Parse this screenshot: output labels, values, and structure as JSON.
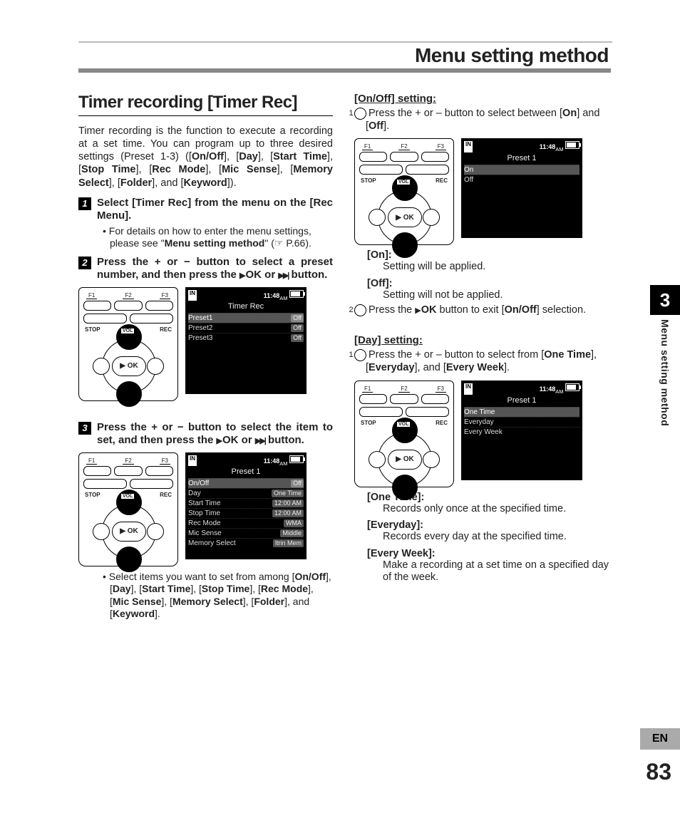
{
  "chapter_title": "Menu setting method",
  "side_tab": {
    "num": "3",
    "label": "Menu setting method"
  },
  "lang_box": "EN",
  "page_number": "83",
  "left": {
    "heading": "Timer recording [Timer Rec]",
    "intro": "Timer recording is the function to execute a recording at a set time. You can program up to three desired settings (Preset 1-3) ([On/Off], [Day], [Start Time], [Stop Time], [Rec Mode], [Mic Sense], [Memory Select], [Folder], and [Keyword]).",
    "step1": "Select [Timer Rec] from the menu on the [Rec Menu].",
    "step1_note_a": "For details on how to enter the menu settings, please see \"",
    "step1_note_b": "Menu setting method",
    "step1_note_c": "\" (☞ P.66).",
    "step2": "Press the + or − button to select a preset number, and then press the ▶OK or ▶▶| button.",
    "step3": "Press the + or − button to select the item to set, and then press the ▶OK or ▶▶| button.",
    "step3_note": "Select items you want to set from among [On/Off], [Day], [Start Time], [Stop Time], [Rec Mode], [Mic Sense], [Memory Select], [Folder], and [Keyword].",
    "fkeys": {
      "f1": "F1",
      "f2": "F2",
      "f3": "F3"
    },
    "stop": "STOP",
    "rec": "REC",
    "vol": "VOL",
    "ok": "▶ OK",
    "lcd_time": "11:48",
    "lcd_am": "AM",
    "lcd1_title": "Timer Rec",
    "lcd1_rows": [
      {
        "l": "Preset1",
        "r": "Off",
        "sel": true
      },
      {
        "l": "Preset2",
        "r": "Off"
      },
      {
        "l": "Preset3",
        "r": "Off"
      }
    ],
    "lcd2_title": "Preset 1",
    "lcd2_rows": [
      {
        "l": "On/Off",
        "r": "Off",
        "sel": true
      },
      {
        "l": "Day",
        "r": "One Time"
      },
      {
        "l": "Start Time",
        "r": "12:00 AM"
      },
      {
        "l": "Stop Time",
        "r": "12:00 AM"
      },
      {
        "l": "Rec Mode",
        "r": "WMA"
      },
      {
        "l": "Mic Sense",
        "r": "Middle"
      },
      {
        "l": "Memory Select",
        "r": "ltrin Mem"
      }
    ]
  },
  "right": {
    "onoff_h": "[On/Off] setting:",
    "onoff_line": "Press the + or – button to select between [On] and [Off].",
    "onoff_lcd_title": "Preset 1",
    "onoff_rows": [
      {
        "l": "On",
        "sel": true
      },
      {
        "l": "Off"
      }
    ],
    "on_def_t": "[On]:",
    "on_def_d": "Setting will be applied.",
    "off_def_t": "[Off]:",
    "off_def_d": "Setting will not be applied.",
    "onoff_exit": "Press the ▶OK button to exit [On/Off] selection.",
    "day_h": "[Day] setting:",
    "day_line": "Press the + or – button to select from [One Time], [Everyday], and [Every Week].",
    "day_lcd_title": "Preset 1",
    "day_rows": [
      {
        "l": "One Time",
        "sel": true
      },
      {
        "l": "Everyday"
      },
      {
        "l": "Every Week"
      }
    ],
    "one_t": "[One Time]:",
    "one_d": "Records only once at the specified time.",
    "ev_t": "[Everyday]:",
    "ev_d": "Records every day at the specified time.",
    "wk_t": "[Every Week]:",
    "wk_d": "Make a recording at a set time on a specified day of the week."
  }
}
